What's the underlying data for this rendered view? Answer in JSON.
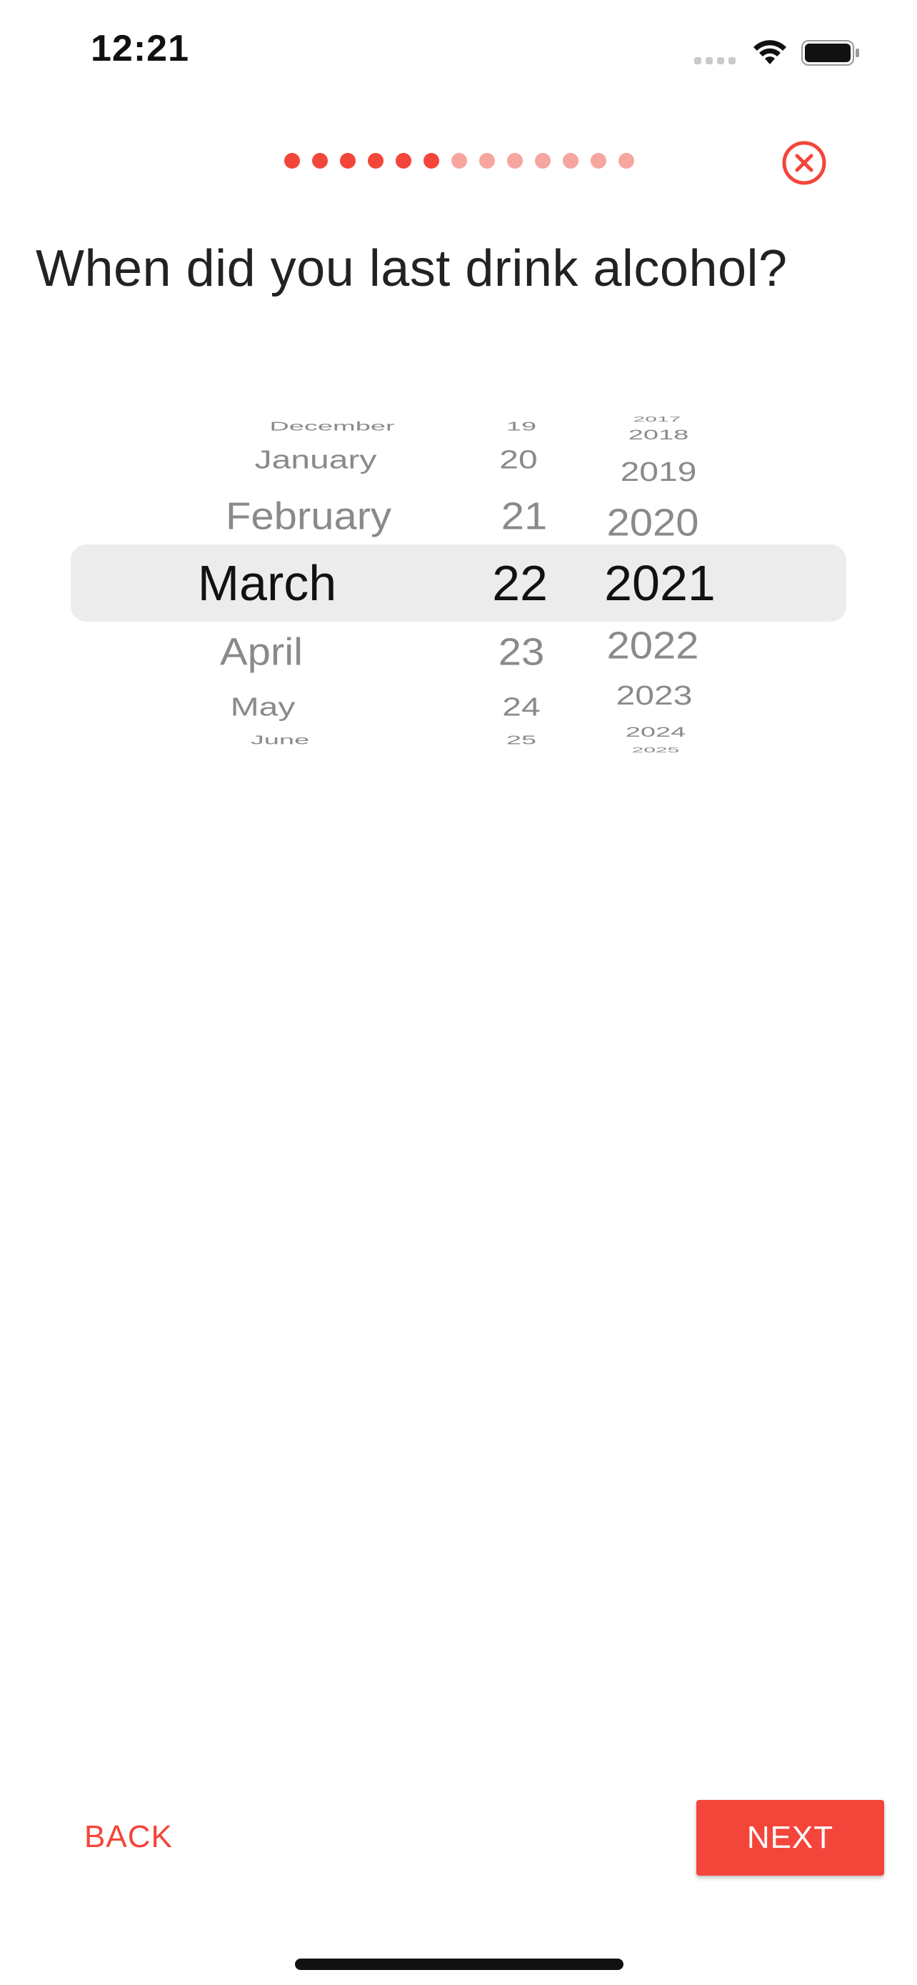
{
  "status_bar": {
    "time": "12:21"
  },
  "progress": {
    "total": 13,
    "completed": 6,
    "active_color": "#f4453a",
    "inactive_color": "#f7a59f"
  },
  "question": "When did you last drink alcohol?",
  "picker": {
    "months": [
      "December",
      "January",
      "February",
      "March",
      "April",
      "May",
      "June"
    ],
    "days": [
      "19",
      "20",
      "21",
      "22",
      "23",
      "24",
      "25"
    ],
    "years": [
      "2017",
      "2018",
      "2019",
      "2020",
      "2021",
      "2022",
      "2023",
      "2024",
      "2025"
    ],
    "selected": {
      "month": "March",
      "day": "22",
      "year": "2021"
    }
  },
  "buttons": {
    "back": "BACK",
    "next": "NEXT"
  },
  "icons": {
    "close": "close-circle-icon",
    "wifi": "wifi-icon",
    "battery": "battery-icon",
    "signal": "cellular-signal-icon"
  }
}
